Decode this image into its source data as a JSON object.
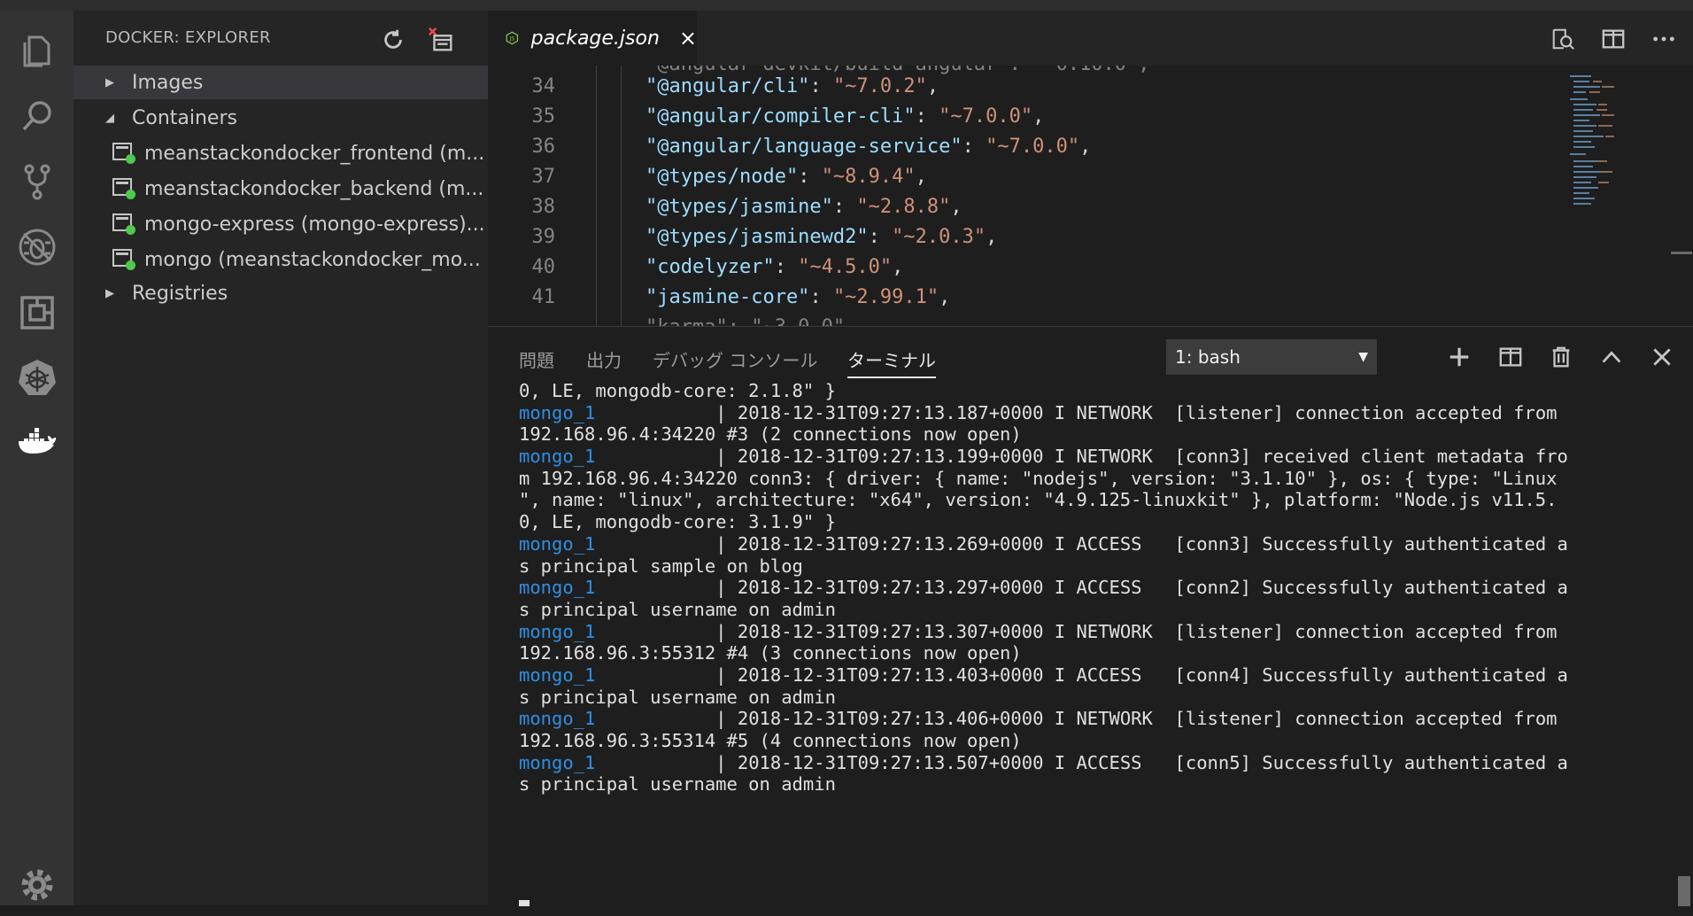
{
  "activity_bar": {
    "items": [
      "explorer-icon",
      "search-icon",
      "source-control-icon",
      "debug-icon",
      "extensions-icon",
      "kubernetes-icon",
      "docker-icon"
    ],
    "bottom": "gear-icon"
  },
  "sidebar": {
    "title": "DOCKER: EXPLORER",
    "actions": [
      "refresh-icon",
      "prune-system-icon"
    ],
    "tree": {
      "images_label": "Images",
      "containers_label": "Containers",
      "containers": [
        "meanstackondocker_frontend (m...",
        "meanstackondocker_backend (m...",
        "mongo-express (mongo-express)...",
        "mongo (meanstackondocker_mo..."
      ],
      "registries_label": "Registries"
    }
  },
  "editor": {
    "tab_label": "package.json",
    "tab_close": "×",
    "actions": [
      "open-changes-icon",
      "split-editor-icon",
      "more-actions-icon"
    ],
    "lines": [
      {
        "n": "34",
        "key": "\"@angular/cli\"",
        "val": "\"~7.0.2\""
      },
      {
        "n": "35",
        "key": "\"@angular/compiler-cli\"",
        "val": "\"~7.0.0\""
      },
      {
        "n": "36",
        "key": "\"@angular/language-service\"",
        "val": "\"~7.0.0\""
      },
      {
        "n": "37",
        "key": "\"@types/node\"",
        "val": "\"~8.9.4\""
      },
      {
        "n": "38",
        "key": "\"@types/jasmine\"",
        "val": "\"~2.8.8\""
      },
      {
        "n": "39",
        "key": "\"@types/jasminewd2\"",
        "val": "\"~2.0.3\""
      },
      {
        "n": "40",
        "key": "\"codelyzer\"",
        "val": "\"~4.5.0\""
      },
      {
        "n": "41",
        "key": "\"jasmine-core\"",
        "val": "\"~2.99.1\""
      }
    ]
  },
  "panel": {
    "tabs": [
      "問題",
      "出力",
      "デバッグ コンソール",
      "ターミナル"
    ],
    "active_tab": "ターミナル",
    "terminal_select": "1: bash",
    "actions": [
      "add-icon",
      "split-terminal-icon",
      "trash-icon",
      "maximize-icon",
      "close-icon"
    ],
    "terminal_lines": [
      {
        "text": "0, LE, mongodb-core: 2.1.8\" }"
      },
      {
        "svc": "mongo_1",
        "text": "           | 2018-12-31T09:27:13.187+0000 I NETWORK  [listener] connection accepted from"
      },
      {
        "text": "192.168.96.4:34220 #3 (2 connections now open)"
      },
      {
        "svc": "mongo_1",
        "text": "           | 2018-12-31T09:27:13.199+0000 I NETWORK  [conn3] received client metadata fro"
      },
      {
        "text": "m 192.168.96.4:34220 conn3: { driver: { name: \"nodejs\", version: \"3.1.10\" }, os: { type: \"Linux"
      },
      {
        "text": "\", name: \"linux\", architecture: \"x64\", version: \"4.9.125-linuxkit\" }, platform: \"Node.js v11.5."
      },
      {
        "text": "0, LE, mongodb-core: 3.1.9\" }"
      },
      {
        "svc": "mongo_1",
        "text": "           | 2018-12-31T09:27:13.269+0000 I ACCESS   [conn3] Successfully authenticated a"
      },
      {
        "text": "s principal sample on blog"
      },
      {
        "svc": "mongo_1",
        "text": "           | 2018-12-31T09:27:13.297+0000 I ACCESS   [conn2] Successfully authenticated a"
      },
      {
        "text": "s principal username on admin"
      },
      {
        "svc": "mongo_1",
        "text": "           | 2018-12-31T09:27:13.307+0000 I NETWORK  [listener] connection accepted from"
      },
      {
        "text": "192.168.96.3:55312 #4 (3 connections now open)"
      },
      {
        "svc": "mongo_1",
        "text": "           | 2018-12-31T09:27:13.403+0000 I ACCESS   [conn4] Successfully authenticated a"
      },
      {
        "text": "s principal username on admin"
      },
      {
        "svc": "mongo_1",
        "text": "           | 2018-12-31T09:27:13.406+0000 I NETWORK  [listener] connection accepted from"
      },
      {
        "text": "192.168.96.3:55314 #5 (4 connections now open)"
      },
      {
        "svc": "mongo_1",
        "text": "           | 2018-12-31T09:27:13.507+0000 I ACCESS   [conn5] Successfully authenticated a"
      },
      {
        "text": "s principal username on admin"
      }
    ]
  },
  "colors": {
    "activity_bar": "#333333",
    "sidebar": "#252526",
    "editor": "#1e1e1e",
    "json_key": "#9cdcfe",
    "json_string": "#ce9178",
    "service_name": "#2f8fe3",
    "container_running": "#4ec94e"
  }
}
